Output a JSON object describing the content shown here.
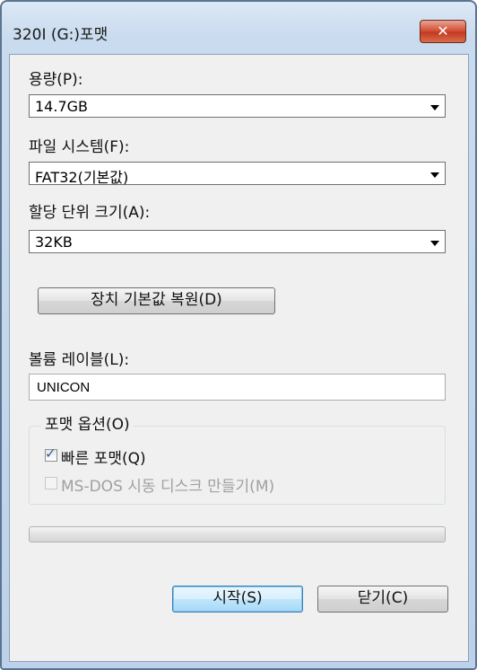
{
  "window": {
    "title": "320I (G:)포맷",
    "close_label": "✕"
  },
  "capacity": {
    "label": "용량(P):",
    "value": "14.7GB"
  },
  "filesystem": {
    "label": "파일 시스템(F):",
    "value": "FAT32(기본값)"
  },
  "alloc": {
    "label": "할당 단위 크기(A):",
    "value": "32KB"
  },
  "restore_defaults_label": "장치 기본값 복원(D)",
  "volume": {
    "label": "볼륨 레이블(L):",
    "value": "UNICON"
  },
  "options": {
    "legend": "포맷 옵션(O)",
    "quick": {
      "label": "빠른 포맷(Q)",
      "checked": true
    },
    "msdos": {
      "label": "MS-DOS 시동 디스크 만들기(M)",
      "checked": false,
      "enabled": false
    }
  },
  "progress": {
    "value": 0
  },
  "buttons": {
    "start": "시작(S)",
    "close": "닫기(C)"
  },
  "icons": {
    "close": "close-icon",
    "dropdown": "chevron-down-icon",
    "check": "checkmark-icon"
  },
  "colors": {
    "close_button": "#c23a20",
    "title_bar": "#c9dbee",
    "default_button_border": "#3c7fb1"
  }
}
